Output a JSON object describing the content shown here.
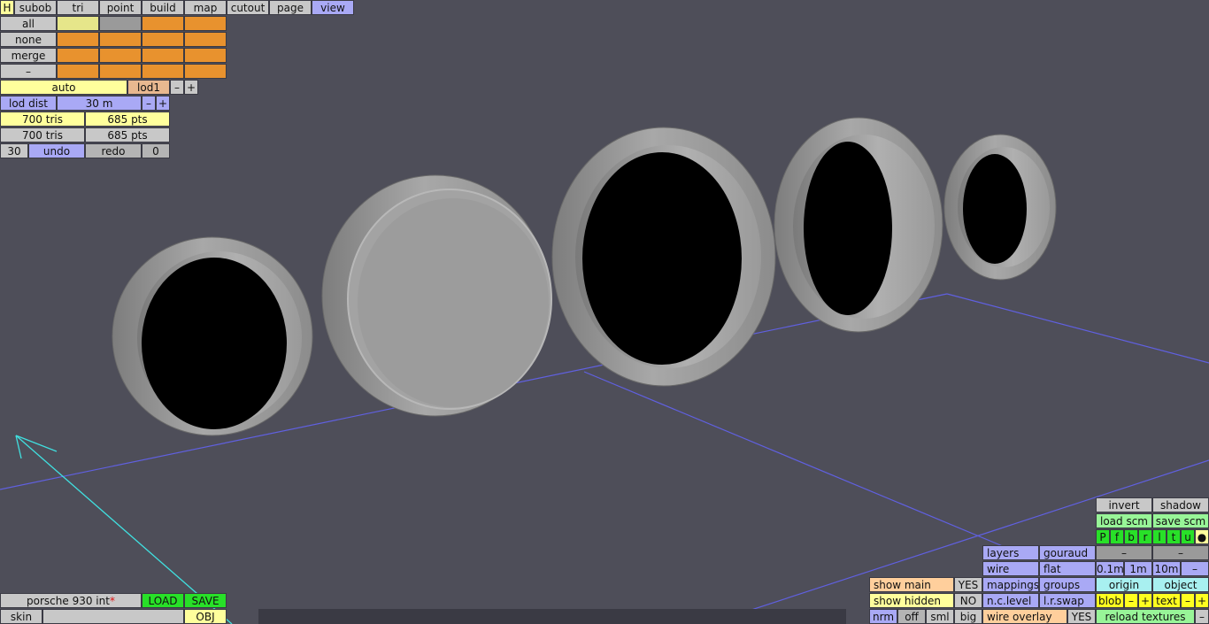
{
  "toolbar": {
    "h": "H",
    "subob": "subob",
    "tri": "tri",
    "point": "point",
    "build": "build",
    "map": "map",
    "cutout": "cutout",
    "page": "page",
    "view": "view"
  },
  "select": {
    "all": "all",
    "none": "none",
    "merge": "merge",
    "minus": "–"
  },
  "lod": {
    "auto": "auto",
    "lod1": "lod1",
    "minus": "–",
    "plus": "+",
    "dist_label": "lod dist",
    "dist_value": "30 m",
    "dist_minus": "–",
    "dist_plus": "+"
  },
  "stats": {
    "tris1": "700 tris",
    "pts1": "685 pts",
    "tris2": "700 tris",
    "pts2": "685 pts"
  },
  "history": {
    "count": "30",
    "undo": "undo",
    "redo": "redo",
    "redo_count": "0"
  },
  "file": {
    "name": "porsche 930 int",
    "modified": "*",
    "load": "LOAD",
    "save": "SAVE",
    "skin": "skin",
    "skin_value": "",
    "obj": "OBJ"
  },
  "display": {
    "show_main": "show main",
    "show_main_val": "YES",
    "show_hidden": "show hidden",
    "show_hidden_val": "NO",
    "nrm": "nrm",
    "off": "off",
    "sml": "sml",
    "big": "big",
    "layers": "layers",
    "gouraud": "gouraud",
    "wire": "wire",
    "flat": "flat",
    "mappings": "mappings",
    "groups": "groups",
    "nc_level": "n.c.level",
    "lr_swap": "l.r.swap",
    "wire_overlay": "wire overlay",
    "wire_overlay_val": "YES"
  },
  "right_panel": {
    "invert": "invert",
    "shadow": "shadow",
    "load_scm": "load scm",
    "save_scm": "save scm",
    "letters": [
      "P",
      "f",
      "b",
      "r",
      "l",
      "t",
      "u",
      "●"
    ],
    "dash1": "–",
    "dash2": "–",
    "s01": "0.1m",
    "s1": "1m",
    "s10": "10m",
    "sminus": "–",
    "origin": "origin",
    "object": "object",
    "blob": "blob",
    "blob_minus": "–",
    "blob_plus": "+",
    "text": "text",
    "text_minus": "–",
    "text_plus": "+",
    "reload": "reload textures",
    "reload_minus": "–"
  },
  "colors": {
    "background": "#4e4e59",
    "grid_line": "#6060e0",
    "axis_line": "#40e0e0",
    "ring": "#9a9a9a"
  }
}
